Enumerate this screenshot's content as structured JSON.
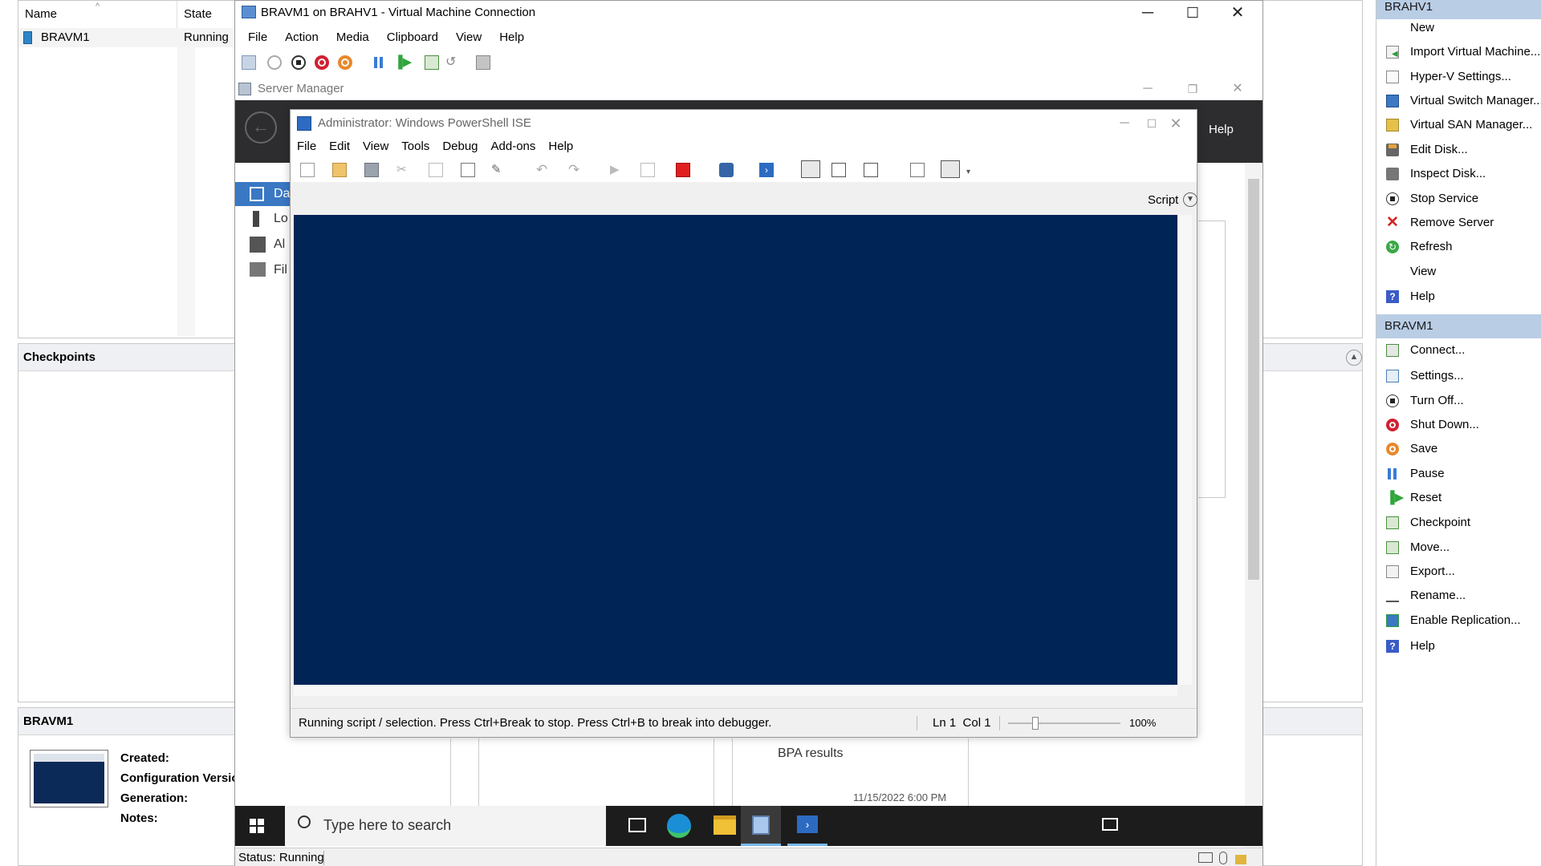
{
  "vms_table": {
    "headers": {
      "name": "Name",
      "state": "State"
    },
    "rows": [
      {
        "name": "BRAVM1",
        "state": "Running"
      }
    ]
  },
  "checkpoints": {
    "title": "Checkpoints"
  },
  "details": {
    "title": "BRAVM1",
    "fields": [
      "Created:",
      "Configuration Versio",
      "Generation:",
      "Notes:"
    ]
  },
  "vm_connection": {
    "title": "BRAVM1 on BRAHV1 - Virtual Machine Connection",
    "menu": [
      "File",
      "Action",
      "Media",
      "Clipboard",
      "View",
      "Help"
    ],
    "status": "Status: Running"
  },
  "server_manager": {
    "title": "Server Manager",
    "help": "Help",
    "nav": [
      "Da",
      "Lo",
      "Al",
      "Fil"
    ],
    "bpa": "BPA results",
    "bpa_time": "11/15/2022 6:00 PM"
  },
  "ise": {
    "title": "Administrator: Windows PowerShell ISE",
    "menu": [
      "File",
      "Edit",
      "View",
      "Tools",
      "Debug",
      "Add-ons",
      "Help"
    ],
    "script_label": "Script",
    "status_text": "Running script / selection.  Press Ctrl+Break to stop.  Press Ctrl+B to break into debugger.",
    "position": "Ln 1  Col 1",
    "zoom": "100%"
  },
  "taskbar": {
    "search_placeholder": "Type here to search"
  },
  "actions": {
    "brahv1_header": "BRAHV1",
    "brahv1_items": [
      {
        "label": "New",
        "icon": "none"
      },
      {
        "label": "Import Virtual Machine...",
        "icon": "import-icon"
      },
      {
        "label": "Hyper-V Settings...",
        "icon": "settings-page-icon"
      },
      {
        "label": "Virtual Switch Manager...",
        "icon": "switch-icon"
      },
      {
        "label": "Virtual SAN Manager...",
        "icon": "san-icon"
      },
      {
        "label": "Edit Disk...",
        "icon": "edit-disk-icon"
      },
      {
        "label": "Inspect Disk...",
        "icon": "inspect-disk-icon"
      },
      {
        "label": "Stop Service",
        "icon": "stop-icon"
      },
      {
        "label": "Remove Server",
        "icon": "red-x-icon"
      },
      {
        "label": "Refresh",
        "icon": "refresh-icon"
      },
      {
        "label": "View",
        "icon": "none"
      },
      {
        "label": "Help",
        "icon": "help-icon"
      }
    ],
    "bravm1_header": "BRAVM1",
    "bravm1_items": [
      {
        "label": "Connect...",
        "icon": "connect-icon"
      },
      {
        "label": "Settings...",
        "icon": "vm-settings-icon"
      },
      {
        "label": "Turn Off...",
        "icon": "turn-off-icon"
      },
      {
        "label": "Shut Down...",
        "icon": "shutdown-icon"
      },
      {
        "label": "Save",
        "icon": "save-state-icon"
      },
      {
        "label": "Pause",
        "icon": "pause-icon"
      },
      {
        "label": "Reset",
        "icon": "reset-icon"
      },
      {
        "label": "Checkpoint",
        "icon": "checkpoint-icon"
      },
      {
        "label": "Move...",
        "icon": "move-icon"
      },
      {
        "label": "Export...",
        "icon": "export-icon"
      },
      {
        "label": "Rename...",
        "icon": "rename-icon"
      },
      {
        "label": "Enable Replication...",
        "icon": "replication-icon"
      },
      {
        "label": "Help",
        "icon": "help-icon"
      }
    ]
  },
  "colors": {
    "console_bg": "#012456",
    "actions_header_bg": "#b9cde5",
    "sm_header_bg": "#2d2d30"
  }
}
